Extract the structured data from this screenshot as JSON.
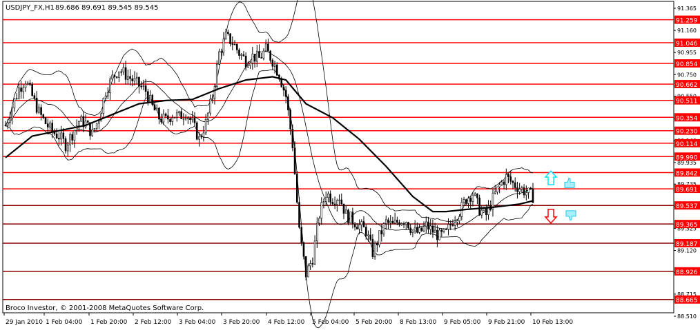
{
  "header": {
    "symbol_label": "USDJPY_FX,H1",
    "ohlc_label": "89.686 89.691 89.545 89.545"
  },
  "footer": {
    "copyright": "Broco Investor, © 2001-2008 MetaQuotes Software Corp."
  },
  "colors": {
    "level_line": "#ff0000",
    "level_line_dark": "#8b0000",
    "level_label_bg": "#ff0000",
    "level_label_text": "#ffffff",
    "candle": "#000000",
    "band": "#000000",
    "ma": "#000000",
    "up_arrow": "#00e5ff",
    "down_arrow": "#ff0000",
    "thumb": "#20c8e8"
  },
  "icons": {
    "up_arrow": "up-arrow-icon",
    "down_arrow": "down-arrow-icon",
    "thumb_up": "thumbs-up-icon",
    "thumb_down": "thumbs-down-icon"
  },
  "chart_data": {
    "type": "candlestick",
    "timeframe": "H1",
    "ylim": [
      88.51,
      91.365
    ],
    "y_ticks": [
      "91.365",
      "91.160",
      "90.955",
      "90.750",
      "90.550",
      "90.345",
      "90.140",
      "89.935",
      "89.735",
      "89.530",
      "89.325",
      "89.120",
      "88.915",
      "88.715",
      "88.510"
    ],
    "x_ticks": [
      "29 Jan 2010",
      "1 Feb 04:00",
      "1 Feb 20:00",
      "2 Feb 12:00",
      "3 Feb 04:00",
      "3 Feb 20:00",
      "4 Feb 12:00",
      "5 Feb 04:00",
      "5 Feb 20:00",
      "8 Feb 13:00",
      "9 Feb 05:00",
      "9 Feb 21:00",
      "10 Feb 13:00"
    ],
    "levels": [
      {
        "value": 91.259,
        "label": "91.259",
        "style": "red"
      },
      {
        "value": 91.046,
        "label": "91.046",
        "style": "red"
      },
      {
        "value": 90.854,
        "label": "90.854",
        "style": "red"
      },
      {
        "value": 90.662,
        "label": "90.662",
        "style": "red"
      },
      {
        "value": 90.511,
        "label": "90.511",
        "style": "red"
      },
      {
        "value": 90.354,
        "label": "90.354",
        "style": "red"
      },
      {
        "value": 90.23,
        "label": "90.230",
        "style": "red"
      },
      {
        "value": 90.114,
        "label": "90.114",
        "style": "red"
      },
      {
        "value": 89.99,
        "label": "89.990",
        "style": "red"
      },
      {
        "value": 89.842,
        "label": "89.842",
        "style": "red"
      },
      {
        "value": 89.691,
        "label": "89.691",
        "style": "red"
      },
      {
        "value": 89.537,
        "label": "89.537",
        "style": "dark"
      },
      {
        "value": 89.365,
        "label": "89.365",
        "style": "dark"
      },
      {
        "value": 89.187,
        "label": "89.187",
        "style": "dark"
      },
      {
        "value": 88.926,
        "label": "88.926",
        "style": "dark"
      },
      {
        "value": 88.665,
        "label": "88.665",
        "style": "dark"
      }
    ],
    "price_path": [
      [
        0,
        90.28
      ],
      [
        3,
        90.45
      ],
      [
        6,
        90.62
      ],
      [
        9,
        90.7
      ],
      [
        12,
        90.55
      ],
      [
        15,
        90.4
      ],
      [
        18,
        90.3
      ],
      [
        21,
        90.22
      ],
      [
        24,
        90.18
      ],
      [
        27,
        90.1
      ],
      [
        30,
        90.2
      ],
      [
        33,
        90.32
      ],
      [
        36,
        90.3
      ],
      [
        39,
        90.2
      ],
      [
        42,
        90.35
      ],
      [
        45,
        90.6
      ],
      [
        48,
        90.72
      ],
      [
        51,
        90.8
      ],
      [
        54,
        90.75
      ],
      [
        57,
        90.7
      ],
      [
        60,
        90.65
      ],
      [
        63,
        90.6
      ],
      [
        66,
        90.45
      ],
      [
        69,
        90.35
      ],
      [
        72,
        90.33
      ],
      [
        75,
        90.38
      ],
      [
        78,
        90.36
      ],
      [
        81,
        90.4
      ],
      [
        84,
        90.3
      ],
      [
        87,
        90.15
      ],
      [
        90,
        90.3
      ],
      [
        93,
        90.55
      ],
      [
        96,
        90.95
      ],
      [
        99,
        91.1
      ],
      [
        102,
        91.05
      ],
      [
        105,
        90.95
      ],
      [
        108,
        90.88
      ],
      [
        111,
        90.92
      ],
      [
        114,
        90.9
      ],
      [
        117,
        90.98
      ],
      [
        120,
        90.88
      ],
      [
        123,
        90.75
      ],
      [
        126,
        90.55
      ],
      [
        129,
        90.1
      ],
      [
        132,
        89.3
      ],
      [
        135,
        88.9
      ],
      [
        138,
        89.05
      ],
      [
        141,
        89.45
      ],
      [
        144,
        89.65
      ],
      [
        147,
        89.6
      ],
      [
        150,
        89.62
      ],
      [
        153,
        89.45
      ],
      [
        156,
        89.4
      ],
      [
        159,
        89.35
      ],
      [
        162,
        89.3
      ],
      [
        165,
        89.1
      ],
      [
        168,
        89.25
      ],
      [
        171,
        89.38
      ],
      [
        174,
        89.35
      ],
      [
        177,
        89.4
      ],
      [
        180,
        89.4
      ],
      [
        183,
        89.3
      ],
      [
        186,
        89.28
      ],
      [
        189,
        89.35
      ],
      [
        192,
        89.3
      ],
      [
        195,
        89.25
      ],
      [
        198,
        89.28
      ],
      [
        201,
        89.4
      ],
      [
        204,
        89.48
      ],
      [
        207,
        89.6
      ],
      [
        210,
        89.65
      ],
      [
        213,
        89.5
      ],
      [
        216,
        89.45
      ],
      [
        219,
        89.6
      ],
      [
        222,
        89.72
      ],
      [
        225,
        89.8
      ],
      [
        228,
        89.74
      ],
      [
        231,
        89.7
      ],
      [
        234,
        89.66
      ],
      [
        237,
        89.62
      ]
    ],
    "ma_path": [
      [
        0,
        89.98
      ],
      [
        12,
        90.18
      ],
      [
        24,
        90.23
      ],
      [
        36,
        90.28
      ],
      [
        48,
        90.38
      ],
      [
        60,
        90.48
      ],
      [
        72,
        90.51
      ],
      [
        84,
        90.52
      ],
      [
        96,
        90.62
      ],
      [
        108,
        90.7
      ],
      [
        120,
        90.73
      ],
      [
        126,
        90.7
      ],
      [
        135,
        90.48
      ],
      [
        147,
        90.35
      ],
      [
        159,
        90.15
      ],
      [
        171,
        89.9
      ],
      [
        183,
        89.62
      ],
      [
        192,
        89.48
      ],
      [
        198,
        89.48
      ],
      [
        207,
        89.5
      ],
      [
        219,
        89.52
      ],
      [
        231,
        89.55
      ],
      [
        237,
        89.58
      ]
    ],
    "annotations": [
      {
        "type": "up-arrow",
        "price": 89.78
      },
      {
        "type": "down-arrow",
        "price": 89.45
      },
      {
        "type": "thumbs-up",
        "price": 89.74
      },
      {
        "type": "thumbs-down",
        "price": 89.45
      }
    ]
  }
}
